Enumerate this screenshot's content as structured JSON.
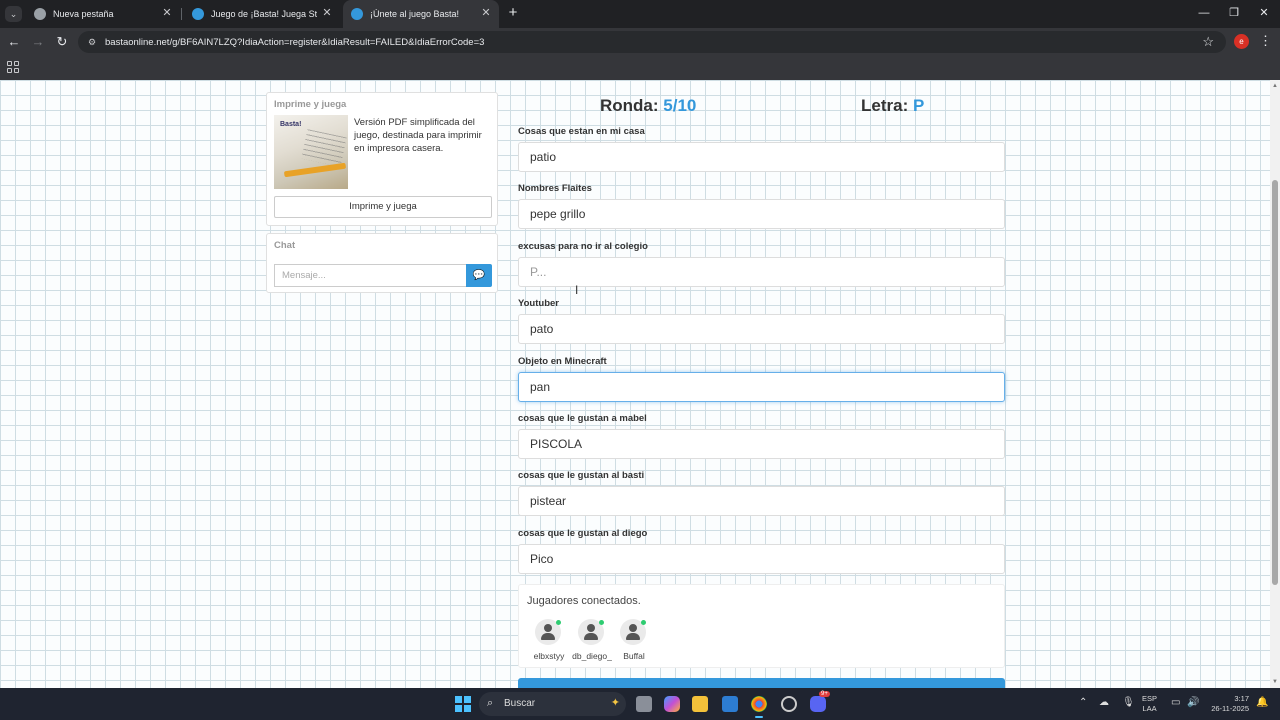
{
  "browser": {
    "tabs": [
      {
        "title": "Nueva pestaña",
        "active": false
      },
      {
        "title": "Juego de ¡Basta! Juega Stop, Tu",
        "active": false
      },
      {
        "title": "¡Únete al juego Basta!",
        "active": true
      }
    ],
    "url": "bastaonline.net/g/BF6AIN7LZQ?IdiaAction=register&IdiaResult=FAILED&IdiaErrorCode=3",
    "profile_initial": "e"
  },
  "sidebar": {
    "print": {
      "title": "Imprime y juega",
      "image_logo": "Basta!",
      "description": "Versión PDF simplificada del juego, destinada para imprimir en impresora casera.",
      "button_label": "Imprime y juega"
    },
    "chat": {
      "title": "Chat",
      "placeholder": "Mensaje..."
    }
  },
  "game": {
    "round_label": "Ronda:",
    "round_value": "5/10",
    "letter_label": "Letra:",
    "letter_value": "P",
    "fields": [
      {
        "label": "Cosas que estan en mi casa",
        "value": "patio",
        "placeholder": ""
      },
      {
        "label": "Nombres Flaites",
        "value": "pepe grillo",
        "placeholder": ""
      },
      {
        "label": "excusas para no ir al colegio",
        "value": "",
        "placeholder": "P..."
      },
      {
        "label": "Youtuber",
        "value": "pato",
        "placeholder": ""
      },
      {
        "label": "Objeto en Minecraft",
        "value": "pan",
        "placeholder": ""
      },
      {
        "label": "cosas que le gustan a mabel",
        "value": "PISCOLA",
        "placeholder": ""
      },
      {
        "label": "cosas que le gustan al basti",
        "value": "pistear",
        "placeholder": ""
      },
      {
        "label": "cosas que le gustan al diego",
        "value": "Pico",
        "placeholder": ""
      }
    ],
    "players_title": "Jugadores conectados.",
    "players": [
      {
        "name": "elbxstyy"
      },
      {
        "name": "db_diego_"
      },
      {
        "name": "Buffal"
      }
    ]
  },
  "taskbar": {
    "search_label": "Buscar",
    "lang_top": "ESP",
    "lang_bottom": "LAA",
    "time": "3:17",
    "date": "26-11-2025",
    "discord_badge": "9+"
  },
  "colors": {
    "accent": "#3498db",
    "online": "#2ecc71",
    "focus": "#66afe9"
  }
}
